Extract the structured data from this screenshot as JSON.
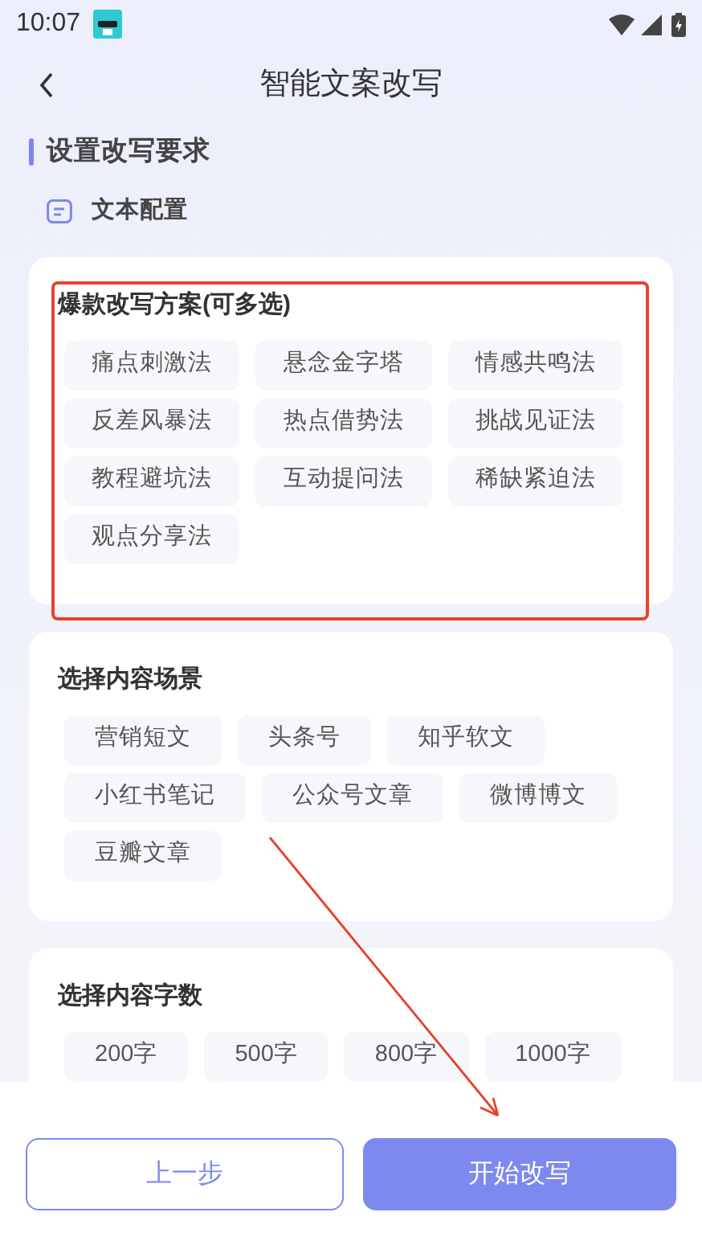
{
  "status_bar": {
    "time": "10:07"
  },
  "header": {
    "title": "智能文案改写"
  },
  "section": {
    "title": "设置改写要求"
  },
  "subsection": {
    "title": "文本配置"
  },
  "groups": [
    {
      "kind": "grid",
      "title": "爆款改写方案(可多选)",
      "options": [
        {
          "label": "痛点刺激法",
          "selected": false
        },
        {
          "label": "悬念金字塔",
          "selected": false
        },
        {
          "label": "情感共鸣法",
          "selected": false
        },
        {
          "label": "反差风暴法",
          "selected": false
        },
        {
          "label": "热点借势法",
          "selected": false
        },
        {
          "label": "挑战见证法",
          "selected": false
        },
        {
          "label": "教程避坑法",
          "selected": false
        },
        {
          "label": "互动提问法",
          "selected": false
        },
        {
          "label": "稀缺紧迫法",
          "selected": false
        },
        {
          "label": "观点分享法",
          "selected": false
        }
      ]
    },
    {
      "kind": "wrap",
      "title": "选择内容场景",
      "options": [
        {
          "label": "营销短文",
          "selected": false
        },
        {
          "label": "头条号",
          "selected": false
        },
        {
          "label": "知乎软文",
          "selected": false
        },
        {
          "label": "小红书笔记",
          "selected": false
        },
        {
          "label": "公众号文章",
          "selected": false
        },
        {
          "label": "微博博文",
          "selected": false
        },
        {
          "label": "豆瓣文章",
          "selected": false
        }
      ]
    },
    {
      "kind": "wrap",
      "title": "选择内容字数",
      "options": [
        {
          "label": "200字",
          "selected": false
        },
        {
          "label": "500字",
          "selected": false
        },
        {
          "label": "800字",
          "selected": false
        },
        {
          "label": "1000字",
          "selected": false
        }
      ]
    }
  ],
  "buttons": [
    {
      "kind": "outline",
      "label": "上一步"
    },
    {
      "kind": "primary",
      "label": "开始改写"
    }
  ]
}
